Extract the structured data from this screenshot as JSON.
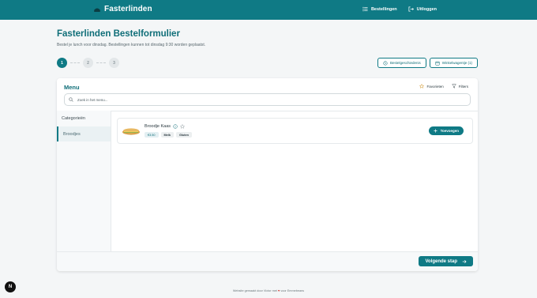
{
  "header": {
    "brand": "Fasterlinden",
    "nav": [
      {
        "label": "Bestellingen",
        "icon": "list-icon"
      },
      {
        "label": "Uitloggen",
        "icon": "logout-icon"
      }
    ]
  },
  "page": {
    "title": "Fasterlinden Bestelformulier",
    "subtitle": "Bestel je lunch voor dinsdag. Bestellingen kunnen tot dinsdag 9:30 worden geplaatst."
  },
  "steps": [
    "1",
    "2",
    "3"
  ],
  "actions": {
    "history": "Bestelgeschiedenis",
    "cart": "Winkelwagentje (1)"
  },
  "menu": {
    "title": "Menu",
    "favorites": "Favorieten",
    "filters": "Filters",
    "search_placeholder": "Zoek in het menu..."
  },
  "sidebar": {
    "heading": "Categorieën",
    "items": [
      "Broodjes"
    ]
  },
  "products": [
    {
      "name": "Broodje Kaas",
      "tags": [
        "€3.50",
        "Melk",
        "Gluten"
      ],
      "add_label": "Toevoegen"
    }
  ],
  "footer_bar": {
    "next_label": "Volgende stap"
  },
  "footer": {
    "pre": "Website gemaakt door Victor met",
    "post": "voor Emmebeans"
  },
  "dev_badge": "N",
  "colors": {
    "accent": "#0f7a85",
    "accent_dark": "#0f6e78",
    "heart": "#d0342c"
  }
}
